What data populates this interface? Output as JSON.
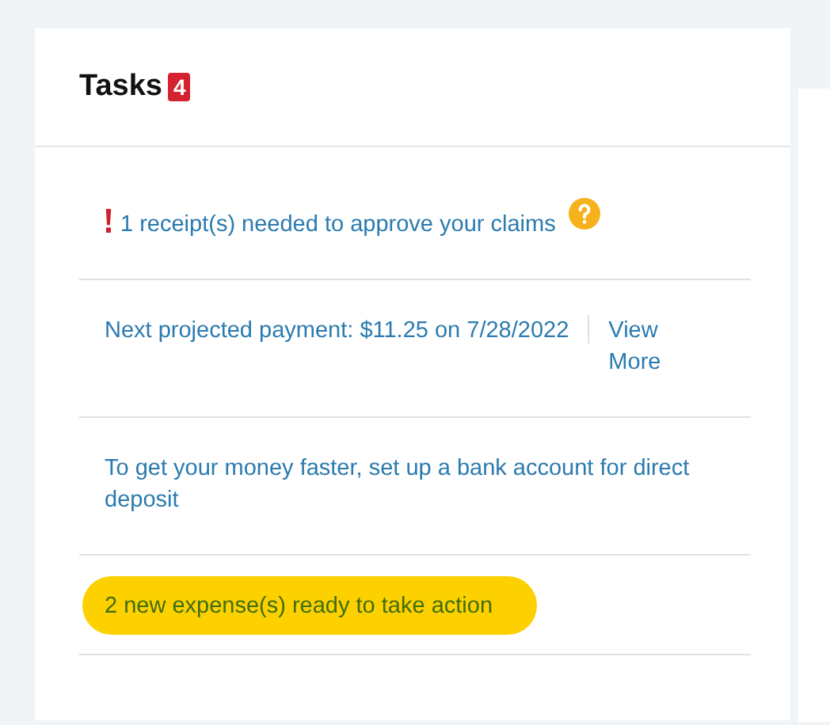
{
  "card": {
    "title": "Tasks",
    "count": "4"
  },
  "tasks": [
    {
      "kind": "alert",
      "text": "1 receipt(s) needed to approve your claims",
      "highlighted": false
    },
    {
      "kind": "payment",
      "text": "Next projected payment: $11.25 on 7/28/2022",
      "link": "View More",
      "highlighted": false
    },
    {
      "kind": "plain",
      "text": "To get your money faster, set up a bank account for direct deposit",
      "highlighted": false
    },
    {
      "kind": "plain",
      "text": "2 new expense(s) ready to take action",
      "highlighted": true
    }
  ]
}
